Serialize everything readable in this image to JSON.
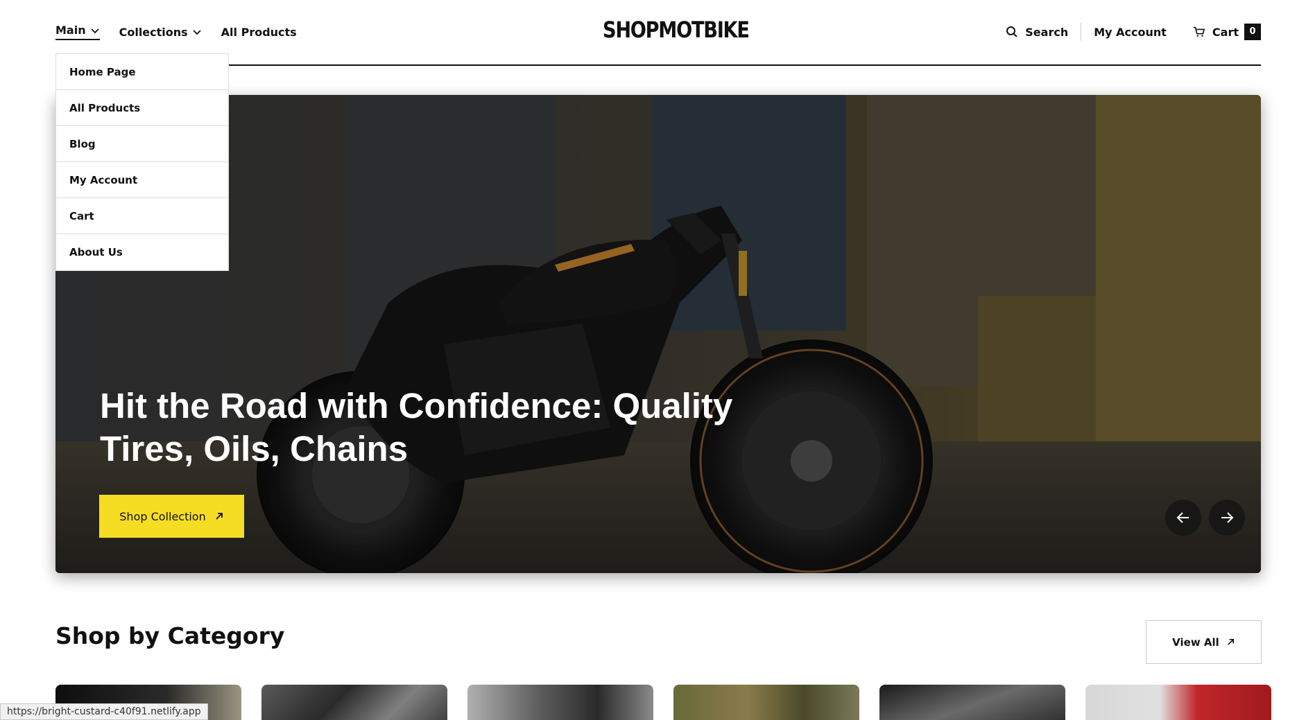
{
  "header": {
    "logo": "SHOPMOTBIKE",
    "nav": [
      {
        "label": "Main",
        "has_dropdown": true,
        "active": true
      },
      {
        "label": "Collections",
        "has_dropdown": true
      },
      {
        "label": "All Products"
      }
    ],
    "search_label": "Search",
    "account_label": "My Account",
    "cart_label": "Cart",
    "cart_count": "0",
    "icons": [
      "search-icon",
      "cart-icon",
      "chevron-down-icon"
    ]
  },
  "dropdown": {
    "items": [
      {
        "label": "Home Page"
      },
      {
        "label": "All Products"
      },
      {
        "label": "Blog"
      },
      {
        "label": "My Account"
      },
      {
        "label": "Cart"
      },
      {
        "label": "About Us"
      }
    ]
  },
  "hero": {
    "title": "Hit the Road with Confidence: Quality Tires, Oils, Chains",
    "button_label": "Shop Collection",
    "accent_color": "#f5dd23",
    "image_description_icon": "motorcycle-photo"
  },
  "category": {
    "title": "Shop by Category",
    "view_all_label": "View All"
  },
  "status_bar": {
    "url": "https://bright-custard-c40f91.netlify.app"
  }
}
